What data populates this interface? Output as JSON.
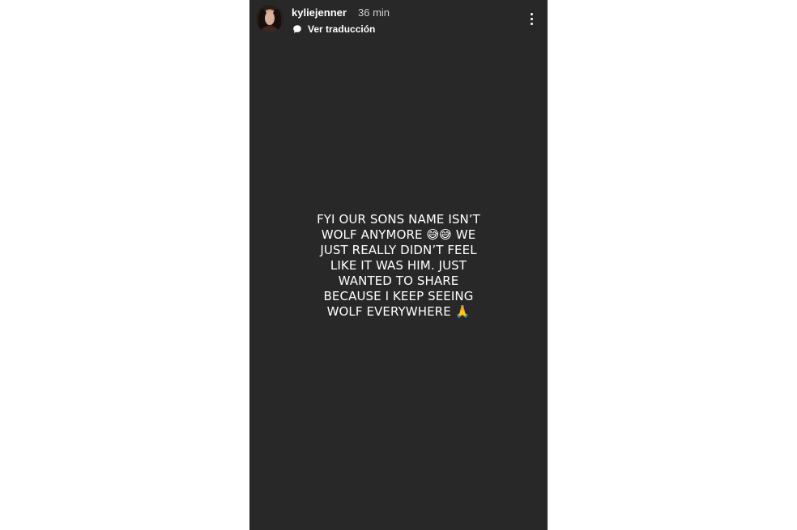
{
  "story": {
    "author": {
      "username": "kyliejenner",
      "posted_ago": "36 min",
      "avatar_icon": "profile-avatar"
    },
    "translation": {
      "label": "Ver traducción",
      "icon": "translation-bubble-icon"
    },
    "menu": {
      "icon": "more-vertical-icon"
    },
    "text_lines": [
      "FYI OUR SONS NAME ISN’T",
      "WOLF ANYMORE 😅😅 WE",
      "JUST REALLY DIDN’T FEEL",
      "LIKE IT WAS HIM. JUST",
      "WANTED TO SHARE",
      "BECAUSE I KEEP SEEING",
      "WOLF EVERYWHERE 🙏"
    ],
    "colors": {
      "background": "#282828",
      "text": "#ffffff",
      "page_background": "#ffffff"
    }
  }
}
